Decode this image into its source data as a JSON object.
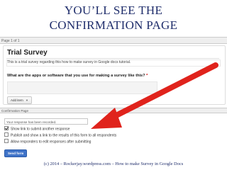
{
  "slide": {
    "title_line1": "YOU’LL SEE THE",
    "title_line2": "CONFIRMATION PAGE",
    "footer": "(c) 2014 – Rockerjay.wordpress.com – How to make Survey in Google Docs"
  },
  "form": {
    "page_label": "Page 1 of 1",
    "title": "Trial Survey",
    "description": "This is a trial survey regarding this how to make survey in Google docs tutorial.",
    "question": "What are the apps or software that you use for making a survey like this?",
    "question_required_marker": "*",
    "answer_value": "",
    "add_item_label": "Add item"
  },
  "confirmation": {
    "section_label": "Confirmation Page",
    "message_value": "Your response has been recorded.",
    "options": [
      {
        "label": "Show link to submit another response",
        "checked": true
      },
      {
        "label": "Publish and show a link to the results of this form to all respondents",
        "checked": false
      },
      {
        "label": "Allow responders to edit responses after submitting",
        "checked": false
      }
    ],
    "send_button": "Send form"
  },
  "colors": {
    "title": "#1f2d6b",
    "arrow": "#e0231c",
    "send_button": "#3f73c8"
  }
}
